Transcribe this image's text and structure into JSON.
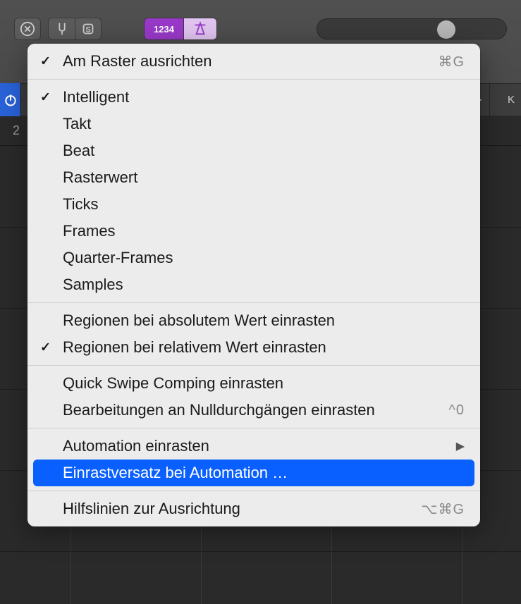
{
  "toolbar": {
    "number_display": "1234"
  },
  "timeline": {
    "marker": "2"
  },
  "secondary": {
    "right_label": "K"
  },
  "menu": {
    "sections": [
      {
        "items": [
          {
            "label": "Am Raster ausrichten",
            "checked": true,
            "shortcut": "⌘G"
          }
        ]
      },
      {
        "items": [
          {
            "label": "Intelligent",
            "checked": true
          },
          {
            "label": "Takt"
          },
          {
            "label": "Beat"
          },
          {
            "label": "Rasterwert"
          },
          {
            "label": "Ticks"
          },
          {
            "label": "Frames"
          },
          {
            "label": "Quarter-Frames"
          },
          {
            "label": "Samples"
          }
        ]
      },
      {
        "items": [
          {
            "label": "Regionen bei absolutem Wert einrasten"
          },
          {
            "label": "Regionen bei relativem Wert einrasten",
            "checked": true
          }
        ]
      },
      {
        "items": [
          {
            "label": "Quick Swipe Comping einrasten"
          },
          {
            "label": "Bearbeitungen an Nulldurchgängen einrasten",
            "shortcut": "^0"
          }
        ]
      },
      {
        "items": [
          {
            "label": "Automation einrasten",
            "submenu": true
          },
          {
            "label": "Einrastversatz bei Automation …",
            "highlighted": true
          }
        ]
      },
      {
        "items": [
          {
            "label": "Hilfslinien zur Ausrichtung",
            "shortcut": "⌥⌘G"
          }
        ]
      }
    ]
  }
}
